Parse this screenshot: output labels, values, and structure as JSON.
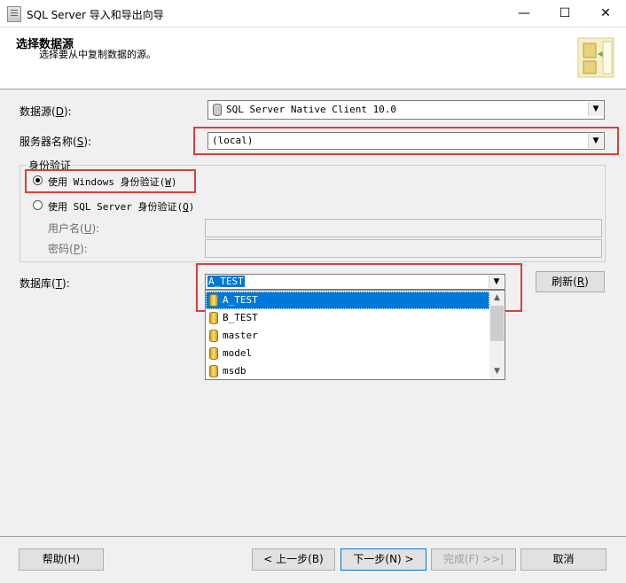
{
  "window": {
    "title": "SQL Server 导入和导出向导",
    "min": "—",
    "max": "☐",
    "close": "✕"
  },
  "header": {
    "title": "选择数据源",
    "subtitle": "选择要从中复制数据的源。"
  },
  "datasource": {
    "label": "数据源",
    "hotkey": "(D):",
    "hotkey_char": "D",
    "value": "SQL Server Native Client 10.0"
  },
  "server": {
    "label": "服务器名称",
    "hotkey_char": "S",
    "value": "(local)"
  },
  "auth": {
    "group_label": "身份验证",
    "windows": {
      "label": "使用 Windows 身份验证",
      "hotkey_char": "W",
      "selected": true
    },
    "sql": {
      "label": "使用 SQL Server 身份验证",
      "hotkey_char": "Q",
      "selected": false
    },
    "username_label": "用户名",
    "username_hotkey": "U",
    "password_label": "密码",
    "password_hotkey": "P",
    "username_value": "",
    "password_value": ""
  },
  "database": {
    "label": "数据库",
    "hotkey_char": "T",
    "value": "A_TEST",
    "refresh_label": "刷新",
    "refresh_hotkey": "R",
    "options": [
      "A_TEST",
      "B_TEST",
      "master",
      "model",
      "msdb"
    ],
    "selected_option": "A_TEST"
  },
  "footer": {
    "help": "帮助(H)",
    "back": "< 上一步(B)",
    "next": "下一步(N) >",
    "finish": "完成(F) >>|",
    "cancel": "取消"
  }
}
